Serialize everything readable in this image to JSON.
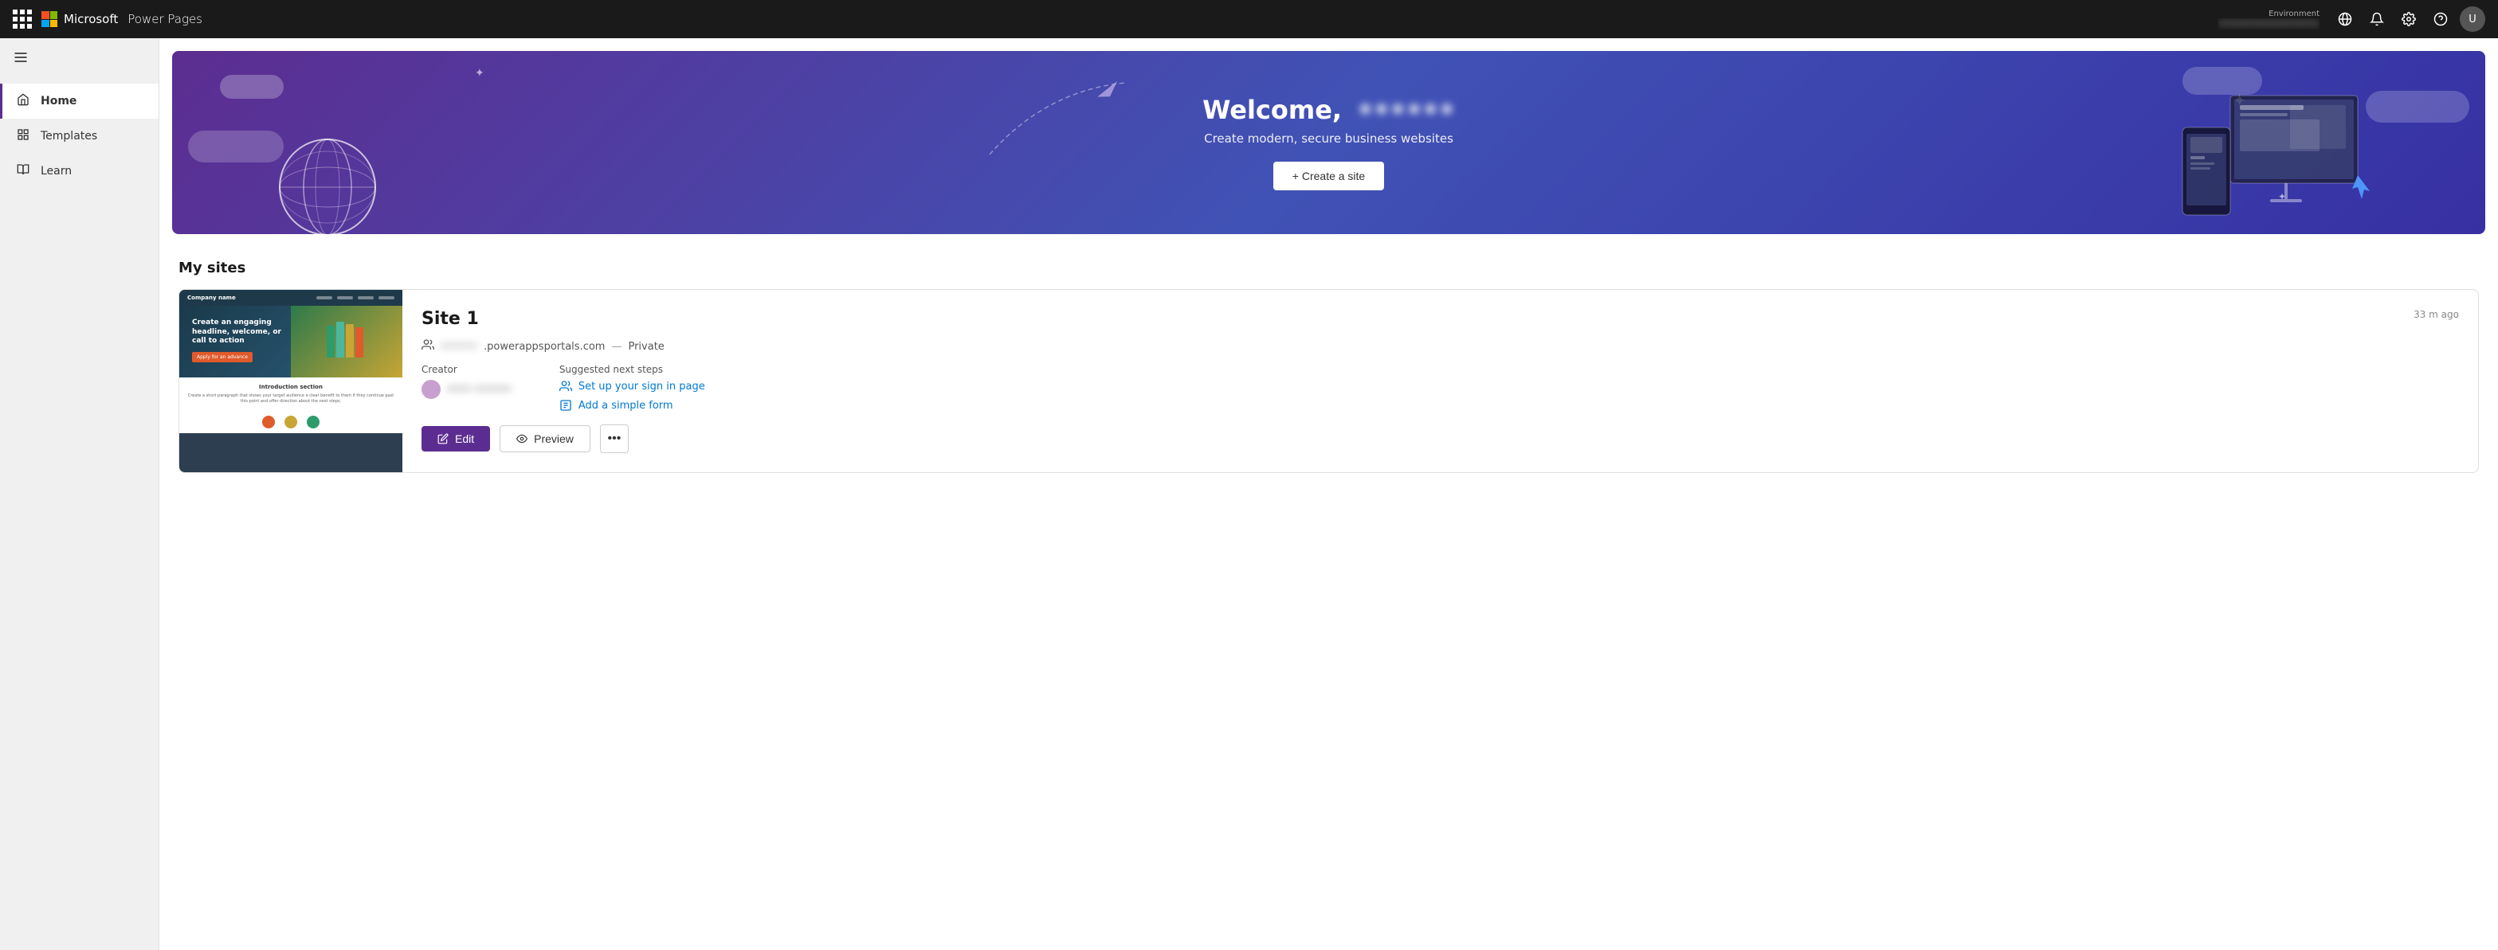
{
  "app": {
    "name": "Power Pages",
    "microsoft_label": "Microsoft"
  },
  "topbar": {
    "environment_label": "Environment",
    "environment_name": "••••••••••••••••••",
    "bell_icon": "🔔",
    "settings_icon": "⚙",
    "help_icon": "?",
    "avatar_initials": "U"
  },
  "sidebar": {
    "toggle_icon": "☰",
    "items": [
      {
        "id": "home",
        "label": "Home",
        "icon": "🏠",
        "active": true
      },
      {
        "id": "templates",
        "label": "Templates",
        "icon": "⊞",
        "active": false
      },
      {
        "id": "learn",
        "label": "Learn",
        "icon": "📖",
        "active": false
      }
    ]
  },
  "hero": {
    "welcome_text": "Welcome,",
    "username": "••••••",
    "subtitle": "Create modern, secure business websites",
    "create_btn_label": "+ Create a site"
  },
  "my_sites": {
    "section_title": "My sites",
    "site1": {
      "name": "Site 1",
      "url_prefix": "••••••",
      "url_domain": ".powerappsportals.com",
      "privacy": "Private",
      "timestamp": "33 m ago",
      "creator_label": "Creator",
      "creator_name": "•••• ••••••",
      "suggested_label": "Suggested next steps",
      "step1_icon": "👥",
      "step1_label": "Set up your sign in page",
      "step2_icon": "📋",
      "step2_label": "Add a simple form",
      "edit_btn": "Edit",
      "preview_btn": "Preview",
      "more_icon": "•••",
      "thumb": {
        "company_name": "Company name",
        "headline": "Create an engaging headline, welcome, or call to action",
        "btn_label": "Apply for an advance",
        "intro_title": "Introduction section",
        "intro_text": "Create a short paragraph that shows your target audience a clear benefit to them if they continue past this point and offer direction about the next steps.",
        "colors": [
          "#e05a2b",
          "#2d9c6a",
          "#c8a535"
        ]
      }
    }
  }
}
